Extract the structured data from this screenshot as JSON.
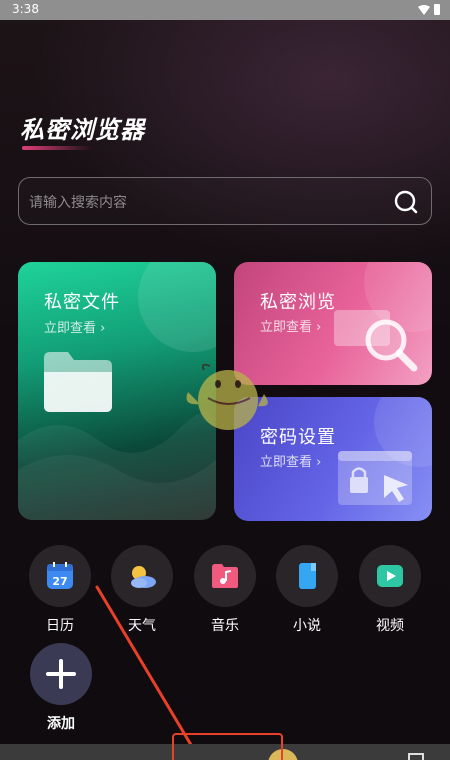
{
  "status_bar": {
    "time": "3:38"
  },
  "app": {
    "title": "私密浏览器"
  },
  "search": {
    "placeholder": "请输入搜索内容"
  },
  "cards": [
    {
      "title": "私密文件",
      "link": "立即查看 ›"
    },
    {
      "title": "私密浏览",
      "link": "立即查看 ›"
    },
    {
      "title": "密码设置",
      "link": "立即查看 ›"
    }
  ],
  "shortcuts": [
    {
      "label": "日历",
      "icon": "calendar-icon",
      "icon_text": "27",
      "color": "#3d8bf2"
    },
    {
      "label": "天气",
      "icon": "weather-icon",
      "color": "#f5c342"
    },
    {
      "label": "音乐",
      "icon": "music-icon",
      "color": "#f05a7e"
    },
    {
      "label": "小说",
      "icon": "novel-icon",
      "color": "#35a7f2"
    },
    {
      "label": "视频",
      "icon": "video-icon",
      "color": "#2fc7a3"
    }
  ],
  "add": {
    "label": "添加"
  },
  "colors": {
    "accent_pink": "#e0407a",
    "files_green": "#1fd39a",
    "browse_pink": "#e8639a",
    "password_blue": "#6364e6",
    "annotation_red": "#e8402a"
  }
}
